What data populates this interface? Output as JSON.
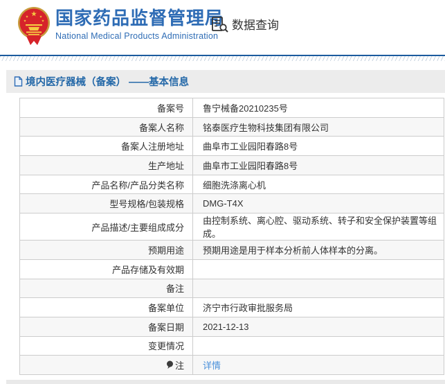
{
  "header": {
    "agency_name_zh": "国家药品监督管理局",
    "agency_name_en": "National Medical Products Administration",
    "nav_query_label": "数据查询"
  },
  "page": {
    "title": "境内医疗器械（备案） ——基本信息"
  },
  "table": {
    "rows": [
      {
        "label": "备案号",
        "value": "鲁宁械备20210235号"
      },
      {
        "label": "备案人名称",
        "value": "铭泰医疗生物科技集团有限公司"
      },
      {
        "label": "备案人注册地址",
        "value": "曲阜市工业园阳春路8号"
      },
      {
        "label": "生产地址",
        "value": "曲阜市工业园阳春路8号"
      },
      {
        "label": "产品名称/产品分类名称",
        "value": "细胞洗涤离心机"
      },
      {
        "label": "型号规格/包装规格",
        "value": "DMG-T4X"
      },
      {
        "label": "产品描述/主要组成成分",
        "value": "由控制系统、离心腔、驱动系统、转子和安全保护装置等组成。"
      },
      {
        "label": "预期用途",
        "value": "预期用途是用于样本分析前人体样本的分离。"
      },
      {
        "label": "产品存储及有效期",
        "value": ""
      },
      {
        "label": "备注",
        "value": ""
      },
      {
        "label": "备案单位",
        "value": "济宁市行政审批服务局"
      },
      {
        "label": "备案日期",
        "value": "2021-12-13"
      },
      {
        "label": "变更情况",
        "value": ""
      }
    ],
    "note_row": {
      "label": "注",
      "link_text": "详情"
    }
  },
  "colors": {
    "brand_blue": "#2e6cb5",
    "rule_blue": "#1b5b9e",
    "title_blue": "#2468a8",
    "link_blue": "#4a90da",
    "row_alt_bg": "#f7f7f7",
    "border_gray": "#cccccc"
  }
}
